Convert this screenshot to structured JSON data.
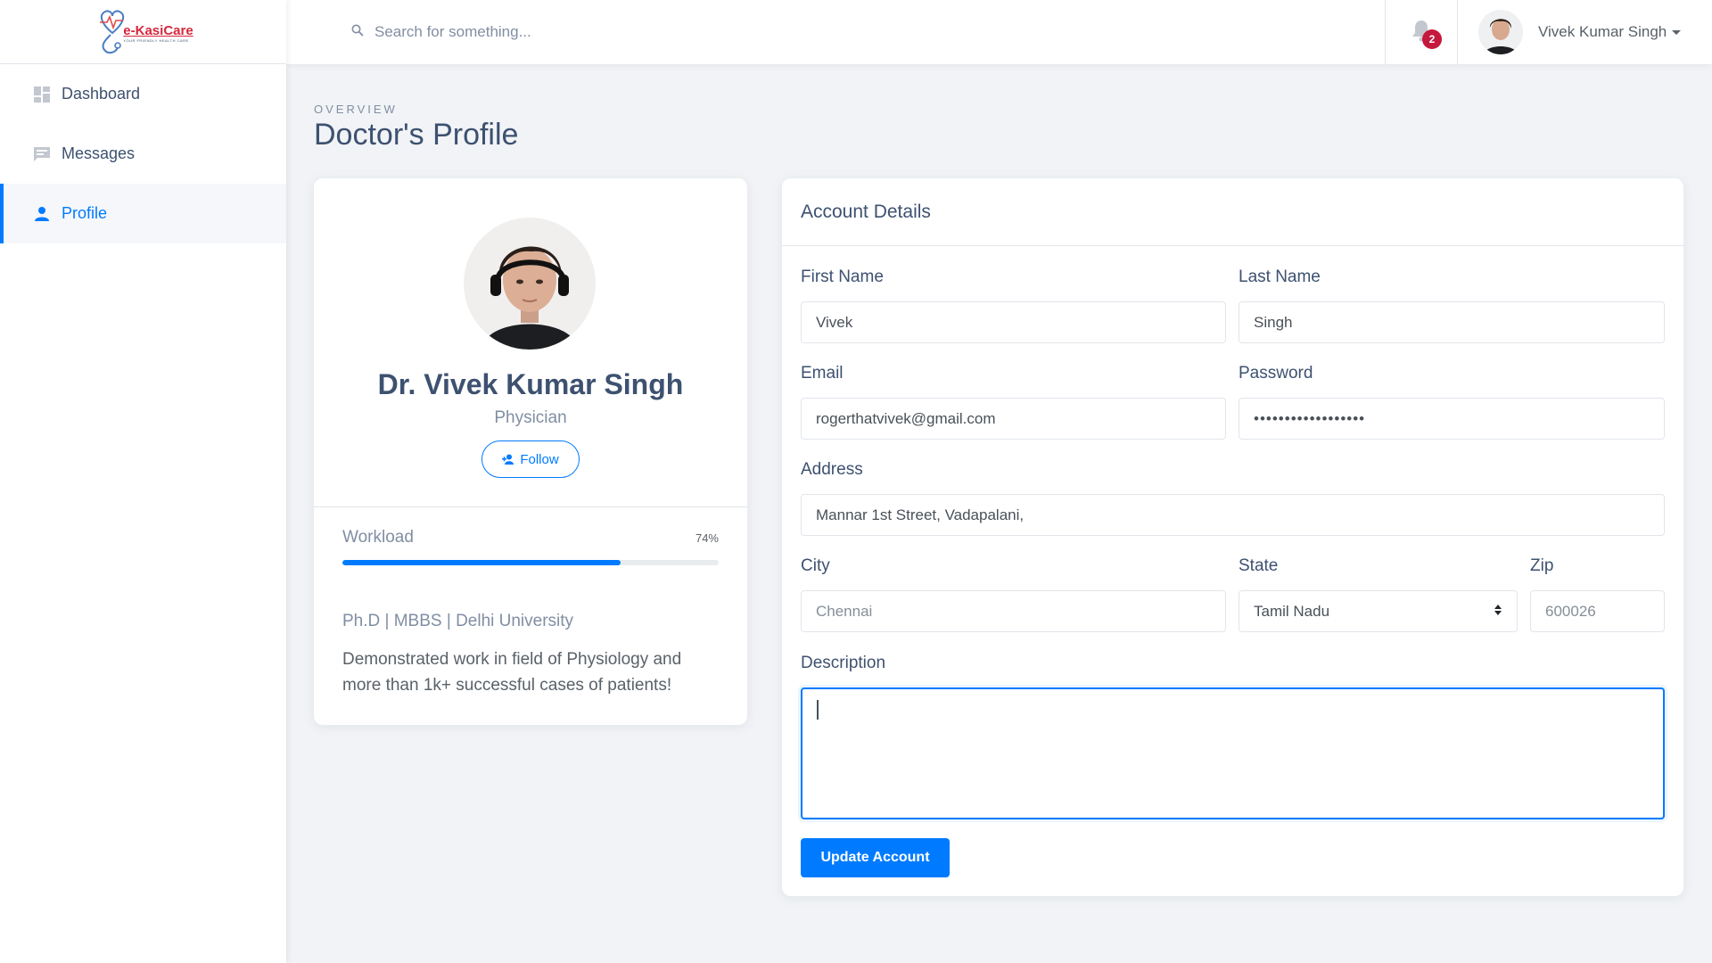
{
  "brand": {
    "name": "e-KasiCare",
    "tagline": "YOUR FRIENDLY HEALTH CARE"
  },
  "sidebar": {
    "items": [
      {
        "label": "Dashboard",
        "icon": "dashboard-icon"
      },
      {
        "label": "Messages",
        "icon": "message-icon"
      },
      {
        "label": "Profile",
        "icon": "person-icon",
        "active": true
      }
    ]
  },
  "topbar": {
    "search_placeholder": "Search for something...",
    "notification_count": "2",
    "user_name": "Vivek Kumar Singh"
  },
  "page": {
    "subtitle": "OVERVIEW",
    "title": "Doctor's Profile"
  },
  "profile": {
    "name": "Dr. Vivek Kumar Singh",
    "role": "Physician",
    "follow_label": "Follow",
    "workload_label": "Workload",
    "workload_text": "74%",
    "workload_fraction": 0.74,
    "education": "Ph.D | MBBS | Delhi University",
    "bio": "Demonstrated work in field of Physiology and more than 1k+ successful cases of patients!"
  },
  "account": {
    "title": "Account Details",
    "first_name_label": "First Name",
    "first_name": "Vivek",
    "last_name_label": "Last Name",
    "last_name": "Singh",
    "email_label": "Email",
    "email": "rogerthatvivek@gmail.com",
    "password_label": "Password",
    "password": "••••••••••••••••••",
    "address_label": "Address",
    "address": "Mannar 1st Street, Vadapalani,",
    "city_label": "City",
    "city_placeholder": "Chennai",
    "state_label": "State",
    "state": "Tamil Nadu",
    "zip_label": "Zip",
    "zip_placeholder": "600026",
    "description_label": "Description",
    "update_label": "Update Account"
  },
  "colors": {
    "accent": "#007bff",
    "badge": "#c4183c",
    "text": "#3d5170",
    "muted": "#818ea3"
  }
}
